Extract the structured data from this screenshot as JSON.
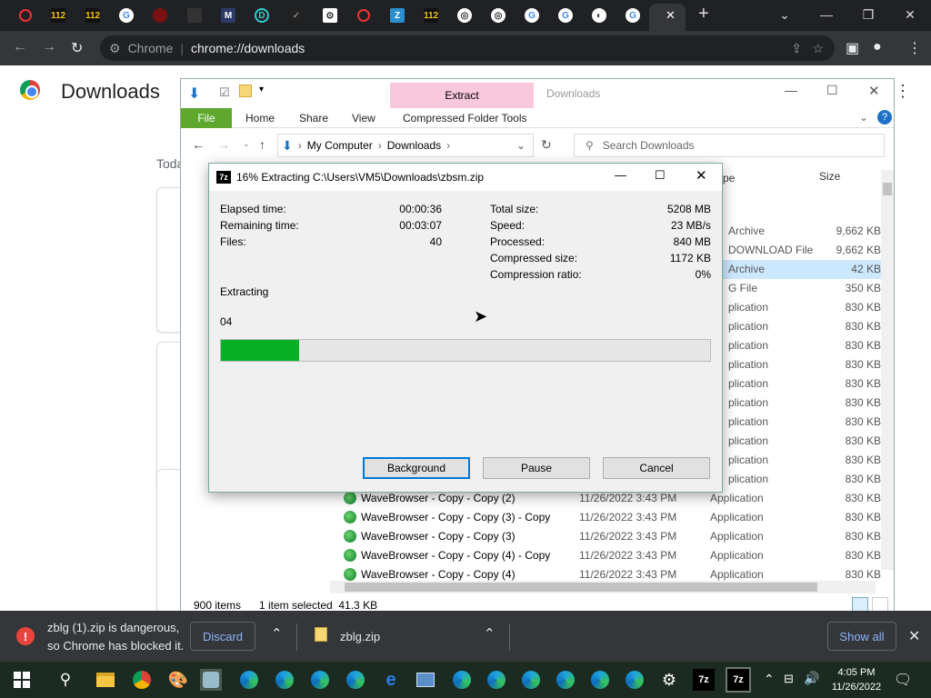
{
  "chrome": {
    "address_prefix": "Chrome",
    "address_url": "chrome://downloads",
    "tab_close": "✕",
    "new_tab": "+"
  },
  "downloads_page": {
    "title": "Downloads",
    "today_label": "Toda"
  },
  "explorer": {
    "title": "Downloads",
    "ribbon_context": "Extract",
    "tabs": [
      "File",
      "Home",
      "Share",
      "View",
      "Compressed Folder Tools"
    ],
    "breadcrumb": [
      "My Computer",
      "Downloads"
    ],
    "search_placeholder": "Search Downloads",
    "col_type_partial": "pe",
    "col_size": "Size",
    "rows_right": [
      {
        "type": "Archive",
        "size": "9,662 KB"
      },
      {
        "type": "DOWNLOAD File",
        "size": "9,662 KB"
      },
      {
        "type": "Archive",
        "size": "42 KB"
      },
      {
        "type": "G File",
        "size": "350 KB"
      },
      {
        "type": "plication",
        "size": "830 KB"
      },
      {
        "type": "plication",
        "size": "830 KB"
      },
      {
        "type": "plication",
        "size": "830 KB"
      },
      {
        "type": "plication",
        "size": "830 KB"
      },
      {
        "type": "plication",
        "size": "830 KB"
      },
      {
        "type": "plication",
        "size": "830 KB"
      },
      {
        "type": "plication",
        "size": "830 KB"
      },
      {
        "type": "plication",
        "size": "830 KB"
      },
      {
        "type": "plication",
        "size": "830 KB"
      },
      {
        "type": "plication",
        "size": "830 KB"
      }
    ],
    "rows_full": [
      {
        "name": "WaveBrowser - Copy - Copy (2)",
        "date": "11/26/2022 3:43 PM",
        "type": "Application",
        "size": "830 KB"
      },
      {
        "name": "WaveBrowser - Copy - Copy (3) - Copy",
        "date": "11/26/2022 3:43 PM",
        "type": "Application",
        "size": "830 KB"
      },
      {
        "name": "WaveBrowser - Copy - Copy (3)",
        "date": "11/26/2022 3:43 PM",
        "type": "Application",
        "size": "830 KB"
      },
      {
        "name": "WaveBrowser - Copy - Copy (4) - Copy",
        "date": "11/26/2022 3:43 PM",
        "type": "Application",
        "size": "830 KB"
      },
      {
        "name": "WaveBrowser - Copy - Copy (4)",
        "date": "11/26/2022 3:43 PM",
        "type": "Application",
        "size": "830 KB"
      }
    ],
    "status_items": "900 items",
    "status_selected": "1 item selected  41.3 KB"
  },
  "zip_dialog": {
    "title": "16% Extracting C:\\Users\\VM5\\Downloads\\zbsm.zip",
    "logo": "7z",
    "elapsed_label": "Elapsed time:",
    "elapsed_value": "00:00:36",
    "remaining_label": "Remaining time:",
    "remaining_value": "00:03:07",
    "files_label": "Files:",
    "files_value": "40",
    "total_label": "Total size:",
    "total_value": "5208 MB",
    "speed_label": "Speed:",
    "speed_value": "23 MB/s",
    "processed_label": "Processed:",
    "processed_value": "840 MB",
    "compressed_label": "Compressed size:",
    "compressed_value": "1172 KB",
    "ratio_label": "Compression ratio:",
    "ratio_value": "0%",
    "status": "Extracting",
    "current_file": "04",
    "progress_fraction": 0.16,
    "btn_background": "Background",
    "btn_pause": "Pause",
    "btn_cancel": "Cancel"
  },
  "shelf": {
    "warning_line1": "zblg (1).zip is dangerous,",
    "warning_line2": "so Chrome has blocked it.",
    "discard": "Discard",
    "file_name": "zblg.zip",
    "show_all": "Show all"
  },
  "taskbar": {
    "time": "4:05 PM",
    "date": "11/26/2022"
  }
}
